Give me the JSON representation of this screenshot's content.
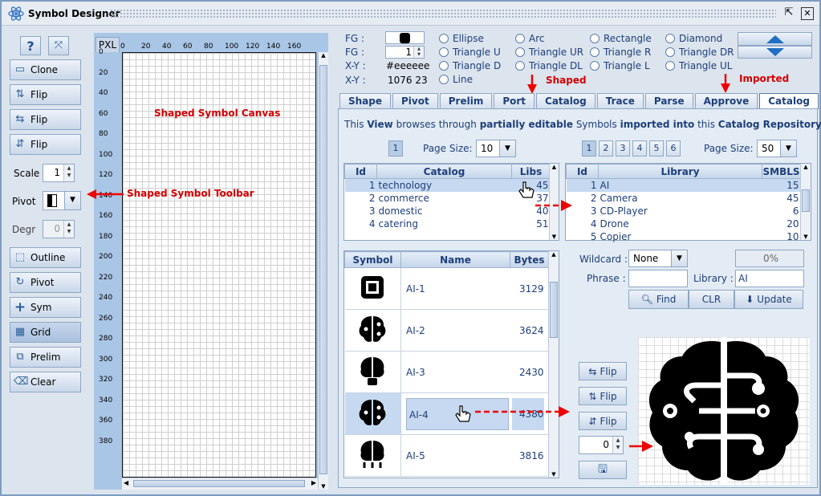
{
  "window": {
    "title": "Symbol Designer",
    "restore_icon": "restore-icon",
    "close_icon": "close-icon"
  },
  "left_toolbar": {
    "help": "?",
    "buttons": [
      {
        "label": "Clone",
        "icon": "clone-icon"
      },
      {
        "label": "Flip",
        "icon": "flip-vertical-icon"
      },
      {
        "label": "Flip",
        "icon": "flip-horizontal-icon"
      },
      {
        "label": "Flip",
        "icon": "flip-rotate-icon"
      }
    ],
    "scale_label": "Scale",
    "scale_value": "1",
    "pivot_label": "Pivot",
    "degr_label": "Degr",
    "degr_value": "0",
    "buttons2": [
      {
        "label": "Outline",
        "icon": "outline-icon"
      },
      {
        "label": "Pivot",
        "icon": "pivot-icon"
      },
      {
        "label": "Sym",
        "icon": "plus-icon"
      },
      {
        "label": "Grid",
        "icon": "grid-icon"
      },
      {
        "label": "Prelim",
        "icon": "prelim-icon"
      },
      {
        "label": "Clear",
        "icon": "eraser-icon"
      }
    ]
  },
  "canvas": {
    "unit": "PXL",
    "x_ticks": [
      "0",
      "20",
      "40",
      "60",
      "80",
      "100",
      "120",
      "140",
      "160"
    ],
    "y_ticks": [
      "0",
      "20",
      "40",
      "60",
      "80",
      "100",
      "120",
      "140",
      "160",
      "180",
      "200",
      "220",
      "240",
      "260",
      "280",
      "300",
      "320",
      "340",
      "360",
      "380"
    ],
    "annotation": "Shaped Symbol Canvas",
    "toolbar_annotation": "Shaped Symbol Toolbar"
  },
  "props": {
    "fg1_label": "FG :",
    "fg2_label": "FG :",
    "fg2_value": "1",
    "xy1_label": "X-Y :",
    "xy1_value": "#eeeeee",
    "xy2_label": "X-Y :",
    "xy2_value": "1076 23"
  },
  "shapes": [
    "Ellipse",
    "Arc",
    "Rectangle",
    "Diamond",
    "Triangle U",
    "Triangle UR",
    "Triangle R",
    "Triangle DR",
    "Triangle D",
    "Triangle DL",
    "Triangle L",
    "Triangle UL",
    "Line"
  ],
  "annotations": {
    "shaped": "Shaped",
    "imported": "Imported"
  },
  "tabs": [
    "Shape",
    "Pivot",
    "Prelim",
    "Port",
    "Catalog",
    "Trace",
    "Parse",
    "Approve",
    "Catalog"
  ],
  "desc": {
    "p1": "This ",
    "b1": "View",
    "p2": " browses through ",
    "b2": "partially editable",
    "p3": " Symbols ",
    "b3": "imported into",
    "p4": " this ",
    "b4": "Catalog Repository"
  },
  "catalog": {
    "pages": [
      "1"
    ],
    "page_size_label": "Page Size:",
    "page_size": "10",
    "headers": [
      "Id",
      "Catalog",
      "Libs"
    ],
    "rows": [
      [
        "1",
        "technology",
        "45"
      ],
      [
        "2",
        "commerce",
        "37"
      ],
      [
        "3",
        "domestic",
        "40"
      ],
      [
        "4",
        "catering",
        "51"
      ]
    ]
  },
  "library": {
    "pages": [
      "1",
      "2",
      "3",
      "4",
      "5",
      "6"
    ],
    "page_size_label": "Page Size:",
    "page_size": "50",
    "headers": [
      "Id",
      "Library",
      "SMBLS"
    ],
    "rows": [
      [
        "1",
        "AI",
        "15"
      ],
      [
        "2",
        "Camera",
        "45"
      ],
      [
        "3",
        "CD-Player",
        "6"
      ],
      [
        "4",
        "Drone",
        "20"
      ],
      [
        "5",
        "Copier",
        "10"
      ]
    ]
  },
  "symbols": {
    "headers": [
      "Symbol",
      "Name",
      "Bytes"
    ],
    "rows": [
      {
        "icon": "chip-icon",
        "name": "AI-1",
        "bytes": "3129"
      },
      {
        "icon": "brain-circuit-icon",
        "name": "AI-2",
        "bytes": "3624"
      },
      {
        "icon": "brain-robot-icon",
        "name": "AI-3",
        "bytes": "2430"
      },
      {
        "icon": "brain-circuit-icon",
        "name": "AI-4",
        "bytes": "4380"
      },
      {
        "icon": "brain-network-icon",
        "name": "AI-5",
        "bytes": "3816"
      }
    ]
  },
  "search": {
    "wildcard_label": "Wildcard :",
    "wildcard_value": "None",
    "progress": "0%",
    "phrase_label": "Phrase :",
    "phrase_value": "",
    "library_label": "Library :",
    "library_value": "AI",
    "find": "Find",
    "clr": "CLR",
    "update": "Update"
  },
  "side_buttons": {
    "flip1": "Flip",
    "flip2": "Flip",
    "flip3": "Flip",
    "rotate_value": "0"
  }
}
